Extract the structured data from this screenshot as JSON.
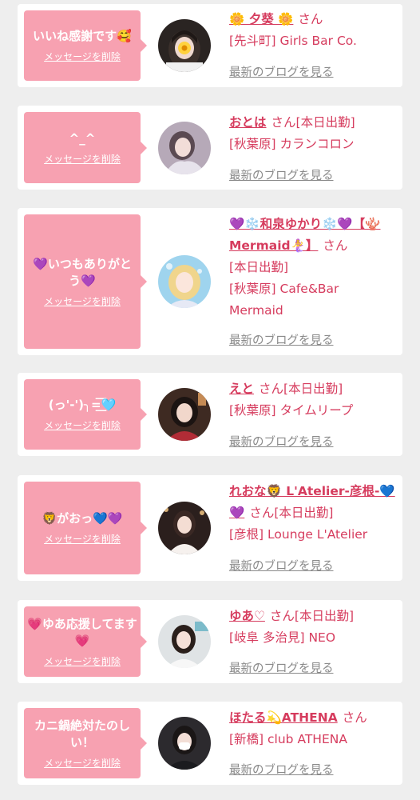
{
  "delete_label": "メッセージを削除",
  "blog_label": "最新のブログを見る",
  "colors": {
    "bubble": "#f7a1b1",
    "accent": "#d63c5e",
    "link_gray": "#8a8a8a"
  },
  "items": [
    {
      "message": "いいね感謝です🥰",
      "name": "🌼 夕葵 🌼",
      "suffix": "さん",
      "status": "",
      "shop": "[先斗町] Girls Bar Co."
    },
    {
      "message": "^_^",
      "name": "おとは",
      "suffix": "さん",
      "status": "[本日出勤]",
      "shop": "[秋葉原] カランコロン"
    },
    {
      "message": "💜いつもありがとう💜",
      "name": "💜❄️和泉ゆかり❄️💜【🪸Mermaid🧜‍♀️】",
      "suffix": "さん",
      "status": "[本日出勤]",
      "shop": "[秋葉原] Cafe&Bar Mermaid"
    },
    {
      "message": "(っ'-')╮=͟͟͞͞🩵",
      "name": "えと",
      "suffix": "さん",
      "status": "[本日出勤]",
      "shop": "[秋葉原] タイムリープ"
    },
    {
      "message": "🦁がおっ💙💜",
      "name": "れおな🦁 L'Atelier-彦根-💙💜",
      "suffix": "さん",
      "status": "[本日出勤]",
      "shop": "[彦根] Lounge L'Atelier"
    },
    {
      "message": "💗ゆあ応援してます💗",
      "name": "ゆあ♡",
      "suffix": "さん",
      "status": "[本日出勤]",
      "shop": "[岐阜 多治見] NEO"
    },
    {
      "message": "カニ鍋絶対たのしい！",
      "name": "ほたる💫ATHENA",
      "suffix": "さん",
      "status": "",
      "shop": "[新橋] club ATHENA"
    }
  ]
}
